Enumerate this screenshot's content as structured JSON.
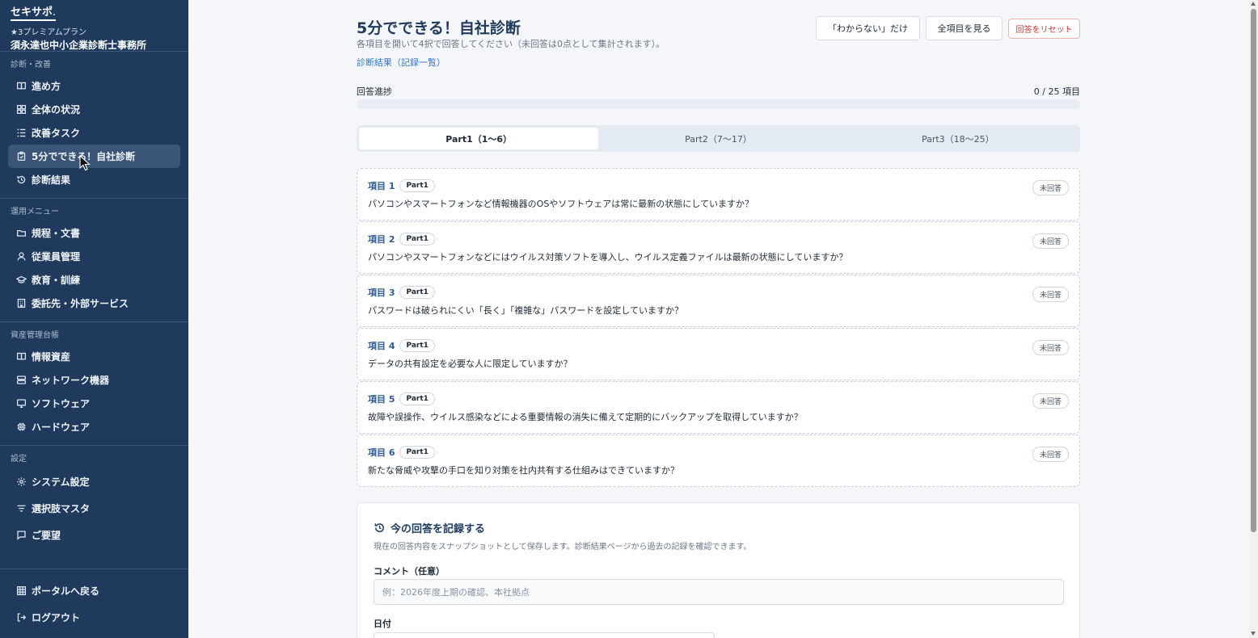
{
  "brand": {
    "logo": "セキサポ",
    "plan": "★3プレミアムプラン",
    "org": "須永達也中小企業診断士事務所"
  },
  "sidebar": {
    "sections": [
      {
        "header": "診断・改善",
        "items": [
          {
            "label": "進め方",
            "icon": "book-icon"
          },
          {
            "label": "全体の状況",
            "icon": "grid-icon"
          },
          {
            "label": "改善タスク",
            "icon": "list-icon"
          },
          {
            "label": "5分でできる！自社診断",
            "icon": "clipboard-icon",
            "active": true
          },
          {
            "label": "診断結果",
            "icon": "history-icon"
          }
        ]
      },
      {
        "header": "運用メニュー",
        "items": [
          {
            "label": "規程・文書",
            "icon": "folder-icon"
          },
          {
            "label": "従業員管理",
            "icon": "user-icon"
          },
          {
            "label": "教育・訓練",
            "icon": "graduation-cap-icon"
          },
          {
            "label": "委託先・外部サービス",
            "icon": "building-icon"
          }
        ]
      },
      {
        "header": "資産管理台帳",
        "items": [
          {
            "label": "情報資産",
            "icon": "book-icon"
          },
          {
            "label": "ネットワーク機器",
            "icon": "server-icon"
          },
          {
            "label": "ソフトウェア",
            "icon": "monitor-icon"
          },
          {
            "label": "ハードウェア",
            "icon": "chip-icon"
          }
        ]
      },
      {
        "header": "設定",
        "items": [
          {
            "label": "システム設定",
            "icon": "gear-icon"
          },
          {
            "label": "選択肢マスタ",
            "icon": "filter-icon"
          },
          {
            "label": "ご要望",
            "icon": "message-icon"
          }
        ]
      }
    ],
    "bottom": [
      {
        "label": "ポータルへ戻る",
        "icon": "grid-icon"
      },
      {
        "label": "ログアウト",
        "icon": "logout-icon"
      }
    ]
  },
  "page": {
    "title": "5分でできる！自社診断",
    "subtitle": "各項目を開いて4択で回答してください（未回答は0点として集計されます）。",
    "results_link": "診断結果（記録一覧）",
    "buttons": {
      "unknown_only": "「わからない」だけ",
      "show_all": "全項目を見る",
      "reset": "回答をリセット"
    },
    "progress": {
      "label": "回答進捗",
      "count_text": "0 / 25 項目",
      "fraction": 0
    },
    "tabs": [
      {
        "label": "Part1（1〜6）",
        "active": true
      },
      {
        "label": "Part2（7〜17）",
        "active": false
      },
      {
        "label": "Part3（18〜25）",
        "active": false
      }
    ],
    "items": [
      {
        "no": "項目 1",
        "tag": "Part1",
        "question": "パソコンやスマートフォンなど情報機器のOSやソフトウェアは常に最新の状態にしていますか？",
        "status": "未回答"
      },
      {
        "no": "項目 2",
        "tag": "Part1",
        "question": "パソコンやスマートフォンなどにはウイルス対策ソフトを導入し、ウイルス定義ファイルは最新の状態にしていますか？",
        "status": "未回答"
      },
      {
        "no": "項目 3",
        "tag": "Part1",
        "question": "パスワードは破られにくい「長く」「複雑な」パスワードを設定していますか？",
        "status": "未回答"
      },
      {
        "no": "項目 4",
        "tag": "Part1",
        "question": "データの共有設定を必要な人に限定していますか？",
        "status": "未回答"
      },
      {
        "no": "項目 5",
        "tag": "Part1",
        "question": "故障や誤操作、ウイルス感染などによる重要情報の消失に備えて定期的にバックアップを取得していますか？",
        "status": "未回答"
      },
      {
        "no": "項目 6",
        "tag": "Part1",
        "question": "新たな脅威や攻撃の手口を知り対策を社内共有する仕組みはできていますか？",
        "status": "未回答"
      }
    ],
    "record": {
      "title": "今の回答を記録する",
      "description": "現在の回答内容をスナップショットとして保存します。診断結果ページから過去の記録を確認できます。",
      "comment_label": "コメント（任意）",
      "comment_placeholder": "例：2026年度上期の確認、本社拠点",
      "date_label": "日付"
    }
  }
}
